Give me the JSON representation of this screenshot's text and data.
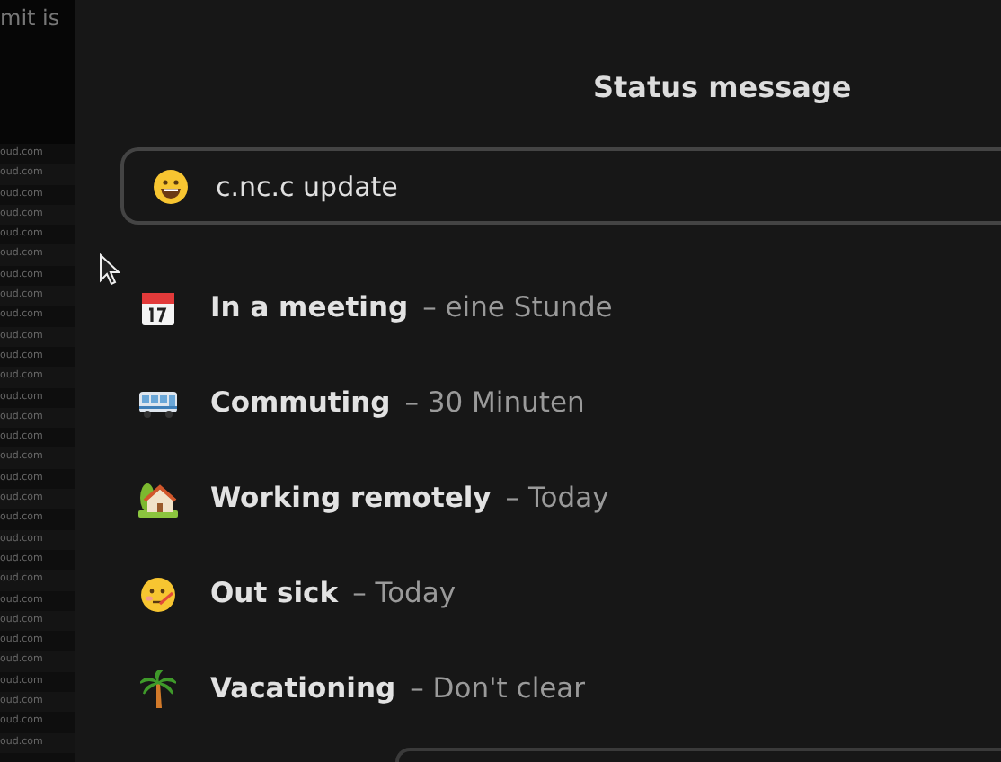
{
  "backdrop": {
    "heading": "mit is",
    "rows": [
      "oud.com",
      "oud.com",
      "oud.com",
      "oud.com",
      "oud.com",
      "oud.com",
      "oud.com",
      "oud.com",
      "oud.com",
      "oud.com",
      "oud.com",
      "oud.com",
      "oud.com",
      "oud.com",
      "oud.com",
      "oud.com",
      "oud.com",
      "oud.com",
      "oud.com",
      "oud.com",
      "oud.com",
      "oud.com",
      "oud.com",
      "oud.com",
      "oud.com",
      "oud.com",
      "oud.com",
      "oud.com",
      "oud.com",
      "oud.com"
    ]
  },
  "dialog": {
    "title": "Status message",
    "message_field": {
      "value": "c.nc.c update"
    },
    "presets": [
      {
        "kind": "calendar",
        "label": "In a meeting",
        "duration": "– eine Stunde"
      },
      {
        "kind": "bus",
        "label": "Commuting",
        "duration": "– 30 Minuten"
      },
      {
        "kind": "house",
        "label": "Working remotely",
        "duration": "– Today"
      },
      {
        "kind": "sick",
        "label": "Out sick",
        "duration": "– Today"
      },
      {
        "kind": "palm",
        "label": "Vacationing",
        "duration": "– Don't clear"
      }
    ]
  }
}
